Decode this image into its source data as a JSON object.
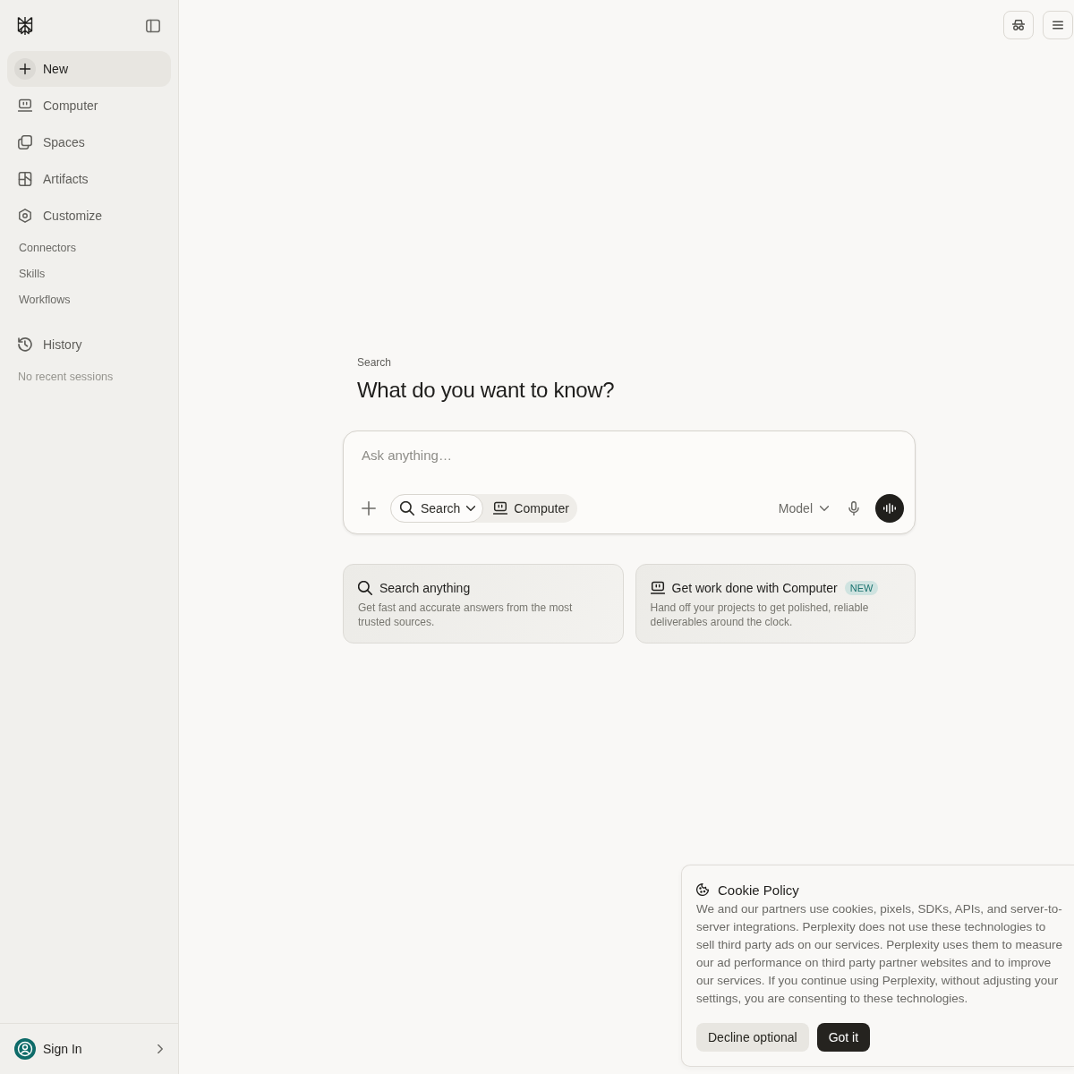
{
  "sidebar": {
    "nav": [
      {
        "label": "New",
        "selected": true
      },
      {
        "label": "Computer",
        "selected": false
      },
      {
        "label": "Spaces",
        "selected": false
      },
      {
        "label": "Artifacts",
        "selected": false
      },
      {
        "label": "Customize",
        "selected": false
      }
    ],
    "sub_items": [
      "Connectors",
      "Skills",
      "Workflows"
    ],
    "history": {
      "label": "History",
      "empty_text": "No recent sessions"
    },
    "account": {
      "label": "Sign In"
    }
  },
  "main": {
    "eyebrow": "Search",
    "heading": "What do you want to know?",
    "composer": {
      "placeholder": "Ask anything…",
      "modes": [
        {
          "label": "Search",
          "selected": true,
          "has_menu": true
        },
        {
          "label": "Computer",
          "selected": false,
          "has_menu": false
        }
      ],
      "model": "Model"
    },
    "cards": [
      {
        "title": "Search anything",
        "description": "Get fast and accurate answers from the most trusted sources."
      },
      {
        "title": "Get work done with Computer",
        "badge": "NEW",
        "description": "Hand off your projects to get polished, reliable deliverables around the clock."
      }
    ]
  },
  "cookie_banner": {
    "title": "Cookie Policy",
    "text": "We and our partners use cookies, pixels, SDKs, APIs, and server-to-server integrations. Perplexity does not use these technologies to sell third party ads on our services. Perplexity uses them to measure our ad performance on third party partner websites and to improve our services. If you continue using Perplexity, without adjusting your settings, you are consenting to these technologies.",
    "buttons": [
      {
        "label": "Decline optional",
        "kind": "secondary"
      },
      {
        "label": "Got it",
        "kind": "primary"
      }
    ]
  }
}
